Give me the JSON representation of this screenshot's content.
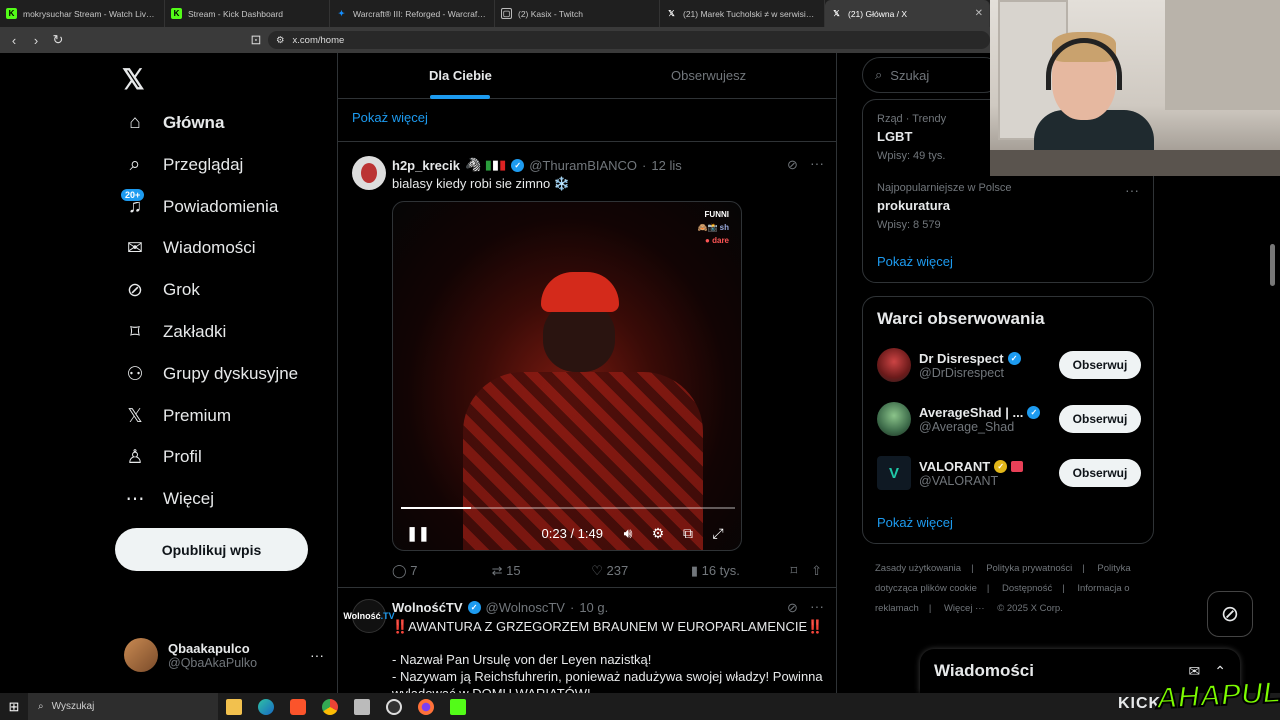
{
  "browser": {
    "tabs": [
      {
        "title": "mokrysuchar Stream - Watch Live on",
        "icon": "kick-icon",
        "color": "#53fc18"
      },
      {
        "title": "Stream - Kick Dashboard",
        "icon": "kick-icon",
        "color": "#53fc18"
      },
      {
        "title": "Warcraft® III: Reforged - Warcraft | B",
        "icon": "battlenet-icon",
        "color": "#148eff"
      },
      {
        "title": "(2) Kasix - Twitch",
        "icon": "twitch-icon",
        "color": "#9146ff"
      },
      {
        "title": "(21) Marek Tucholski ≠ w serwisie X",
        "icon": "x-icon",
        "color": "#ffffff"
      },
      {
        "title": "(21) Główna / X",
        "icon": "x-icon",
        "color": "#ffffff"
      }
    ],
    "url": "x.com/home"
  },
  "nav": {
    "items": [
      {
        "label": "Główna",
        "icon": "home-icon"
      },
      {
        "label": "Przeglądaj",
        "icon": "search-icon"
      },
      {
        "label": "Powiadomienia",
        "icon": "bell-icon",
        "badge": "20+"
      },
      {
        "label": "Wiadomości",
        "icon": "mail-icon"
      },
      {
        "label": "Grok",
        "icon": "grok-icon"
      },
      {
        "label": "Zakładki",
        "icon": "bookmark-icon"
      },
      {
        "label": "Grupy dyskusyjne",
        "icon": "communities-icon"
      },
      {
        "label": "Premium",
        "icon": "x-icon"
      },
      {
        "label": "Profil",
        "icon": "person-icon"
      },
      {
        "label": "Więcej",
        "icon": "more-icon"
      }
    ],
    "post_button": "Opublikuj wpis",
    "user": {
      "name": "Qbaakapulco",
      "handle": "@QbaAkaPulko"
    }
  },
  "feed": {
    "tabs": [
      "Dla Ciebie",
      "Obserwujesz"
    ],
    "show_more": "Pokaż więcej",
    "tweet1": {
      "name": "h2p_krecik",
      "handle": "@ThuramBIANCO",
      "time": "12 lis",
      "text": "bialasy kiedy robi sie zimno ❄️",
      "video": {
        "time": "0:23 / 1:49",
        "progress": 0.21,
        "overlay": [
          "FUNNI",
          "🙈📸 sh",
          "● dare"
        ]
      },
      "replies": "7",
      "reposts": "15",
      "likes": "237",
      "views": "16 tys."
    },
    "tweet2": {
      "name": "WolnośćTV",
      "handle": "@WolnoscTV",
      "time": "10 g.",
      "line1": "‼️AWANTURA Z GRZEGORZEM BRAUNEM W EUROPARLAMENCIE‼️",
      "line2": "- Nazwał Pan Ursulę von der Leyen nazistką!",
      "line3": "- Nazywam ją Reichsfuhrerin, ponieważ nadużywa swojej władzy! Powinna",
      "line4": "wylądować w DOMU WARIATÓW!"
    }
  },
  "right": {
    "search_placeholder": "Szukaj",
    "trends": [
      {
        "meta": "Rząd · Trendy",
        "name": "LGBT",
        "count": "Wpisy: 49 tys."
      },
      {
        "meta": "Najpopularniejsze w Polsce",
        "name": "prokuratura",
        "count": "Wpisy: 8 579"
      }
    ],
    "trends_more": "Pokaż więcej",
    "wtf_title": "Warci obserwowania",
    "wtf": [
      {
        "name": "Dr Disrespect",
        "handle": "@DrDisrespect",
        "button": "Obserwuj",
        "badge": "blue",
        "color": "#8b1f1f"
      },
      {
        "name": "AverageShad | ...",
        "handle": "@Average_Shad",
        "button": "Obserwuj",
        "badge": "blue",
        "color": "#3d6b4a"
      },
      {
        "name": "VALORANT",
        "handle": "@VALORANT",
        "button": "Obserwuj",
        "badge": "gold",
        "color": "#0f1923"
      }
    ],
    "wtf_more": "Pokaż więcej",
    "footer": [
      "Zasady użytkowania",
      "|",
      "Polityka prywatności",
      "|",
      "Polityka dotycząca plików cookie",
      "|",
      "Dostępność",
      "|",
      "Informacja o reklamach",
      "|",
      "Więcej ···",
      "© 2025 X Corp."
    ],
    "messages": "Wiadomości"
  },
  "taskbar": {
    "search": "Wyszukaj"
  },
  "overlay": {
    "kick": "KICK",
    "brand": "AHAPULCO"
  }
}
